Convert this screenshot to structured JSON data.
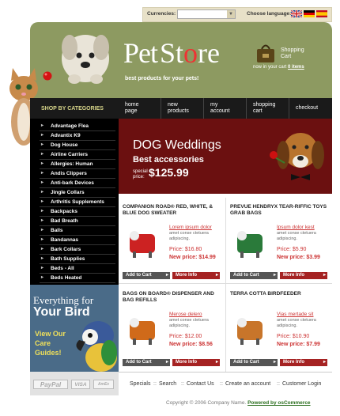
{
  "topbar": {
    "currencies_label": "Currencies:",
    "currency_selected": "",
    "language_label": "Choose language:"
  },
  "header": {
    "logo_pet": "Pet",
    "logo_store_s": "St",
    "logo_store_o": "o",
    "logo_store_end": "re",
    "tagline": "best products for your pets!",
    "cart_title_1": "Shopping",
    "cart_title_2": "Cart",
    "cart_status_prefix": "now in your cart",
    "cart_items": "0 items"
  },
  "nav": [
    {
      "line1": "home",
      "line2": "page"
    },
    {
      "line1": "new",
      "line2": "products"
    },
    {
      "line1": "my",
      "line2": "account"
    },
    {
      "line1": "shopping",
      "line2": "cart"
    },
    {
      "line1": "checkout",
      "line2": ""
    }
  ],
  "sidebar": {
    "heading": "SHOP BY CATEGORIES",
    "categories": [
      "Advantage Flea",
      "Advantix K9",
      "Dog House",
      "Airline Carriers",
      "Allergies: Human",
      "Andis Clippers",
      "Anti-bark Devices",
      "Jingle Collars",
      "Arthritis Supplements",
      "Backpacks",
      "Bad Breath",
      "Balls",
      "Bandannas",
      "Bark Collars",
      "Bath Supplies",
      "Beds - All",
      "Beds Heated"
    ]
  },
  "bird_banner": {
    "line1": "Everything for",
    "line2": "Your Bird",
    "line3": "View Our",
    "line4": "Care",
    "line5": "Guides!"
  },
  "payments": [
    "PayPal",
    "VISA",
    "AmEx"
  ],
  "main_banner": {
    "title": "DOG Weddings",
    "subtitle": "Best accessories",
    "special_1": "special",
    "special_2": "price:",
    "price": "$125.99"
  },
  "products": [
    {
      "title": "COMPANION ROAD® RED, WHITE, & BLUE DOG SWEATER",
      "name": "Lorem ipsum dolor",
      "desc": "amet conse ctetuera adipiscing.",
      "price": "Price: $16.80",
      "new_price": "New price: $14.99",
      "add": "Add to Cart",
      "more": "More Info"
    },
    {
      "title": "PREVUE HENDRYX TEAR-RIFFIC TOYS GRAB BAGS",
      "name": "Ipsum dolor kest",
      "desc": "amet conse ctetuera adipiscing.",
      "price": "Price: $5.90",
      "new_price": "New price: $3.99",
      "add": "Add to Cart",
      "more": "More Info"
    },
    {
      "title": "BAGS ON BOARD® DISPENSER AND BAG REFILLS",
      "name": "Merose delero",
      "desc": "amet conse ctetuera adipiscing.",
      "price": "Price: $12.00",
      "new_price": "New price: $8.56",
      "add": "Add to Cart",
      "more": "More Info"
    },
    {
      "title": "TERRA COTTA BIRDFEEDER",
      "name": "Vias mertade sit",
      "desc": "amet conse ctetuera adipiscing.",
      "price": "Price: $10.90",
      "new_price": "New price: $7.99",
      "add": "Add to Cart",
      "more": "More Info"
    }
  ],
  "footer": {
    "links": [
      "Specials",
      "Search",
      "Contact Us",
      "Create an account",
      "Customer Login"
    ],
    "copyright": "Copyright © 2006 Company Name.",
    "powered": "Powered by osCommerce"
  },
  "colors": {
    "header_green": "#8d9a61",
    "banner_red": "#6b1010",
    "accent_red": "#cc3333",
    "nav_black": "#1a1a1a"
  }
}
